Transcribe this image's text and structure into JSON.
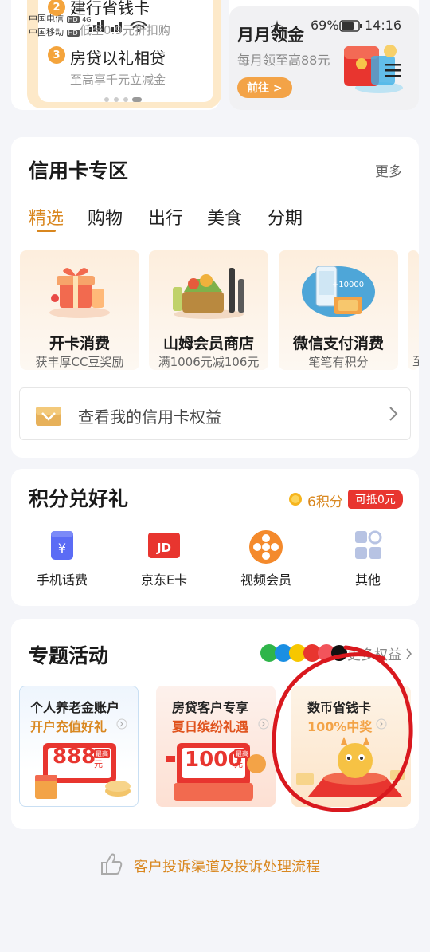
{
  "status_bar": {
    "carrier1": "中国电信",
    "carrier2": "中国移动",
    "hd": "HD",
    "net": "4G",
    "battery": "69%",
    "time": "14:16"
  },
  "top_left": {
    "item2_num": "2",
    "item2_title": "建行省钱卡",
    "item2_sub": "低至0.9元折扣购",
    "item3_num": "3",
    "item3_title": "房贷以礼相贷",
    "item3_sub": "至高享千元立减金"
  },
  "top_right": {
    "title": "月月领金",
    "sub": "每月领至高88元",
    "button": "前往 >"
  },
  "credit": {
    "title": "信用卡专区",
    "more": "更多",
    "tabs": [
      "精选",
      "购物",
      "出行",
      "美食",
      "分期"
    ],
    "cards": [
      {
        "title": "开卡消费",
        "sub": "获丰厚CC豆奖励"
      },
      {
        "title": "山姆会员商店",
        "sub": "满1006元减106元"
      },
      {
        "title": "微信支付消费",
        "sub": "笔笔有积分"
      }
    ],
    "card_badge": "+10000",
    "peek_sub": "至",
    "rights": "查看我的信用卡权益"
  },
  "points": {
    "title": "积分兑好礼",
    "balance": "6积分",
    "deduct": "可抵0元",
    "items": [
      {
        "label": "手机话费",
        "icon": "phone-bill-icon"
      },
      {
        "label": "京东E卡",
        "icon": "jd-card-icon"
      },
      {
        "label": "视频会员",
        "icon": "video-member-icon"
      },
      {
        "label": "其他",
        "icon": "other-grid-icon"
      }
    ]
  },
  "activity": {
    "title": "专题活动",
    "more": "更多权益",
    "cards": [
      {
        "title": "个人养老金账户",
        "sub": "开户充值好礼",
        "amount": "888",
        "tag": "最高",
        "unit": "元"
      },
      {
        "title": "房贷客户专享",
        "sub": "夏日缤纷礼遇",
        "amount": "1000",
        "tag": "最高",
        "unit": "元"
      },
      {
        "title": "数币省钱卡",
        "sub": "100%中奖"
      }
    ]
  },
  "complaint": "客户投诉渠道及投诉处理流程",
  "colors": {
    "accent": "#d9871f",
    "red": "#e8352f",
    "annotation": "#d9181e"
  }
}
